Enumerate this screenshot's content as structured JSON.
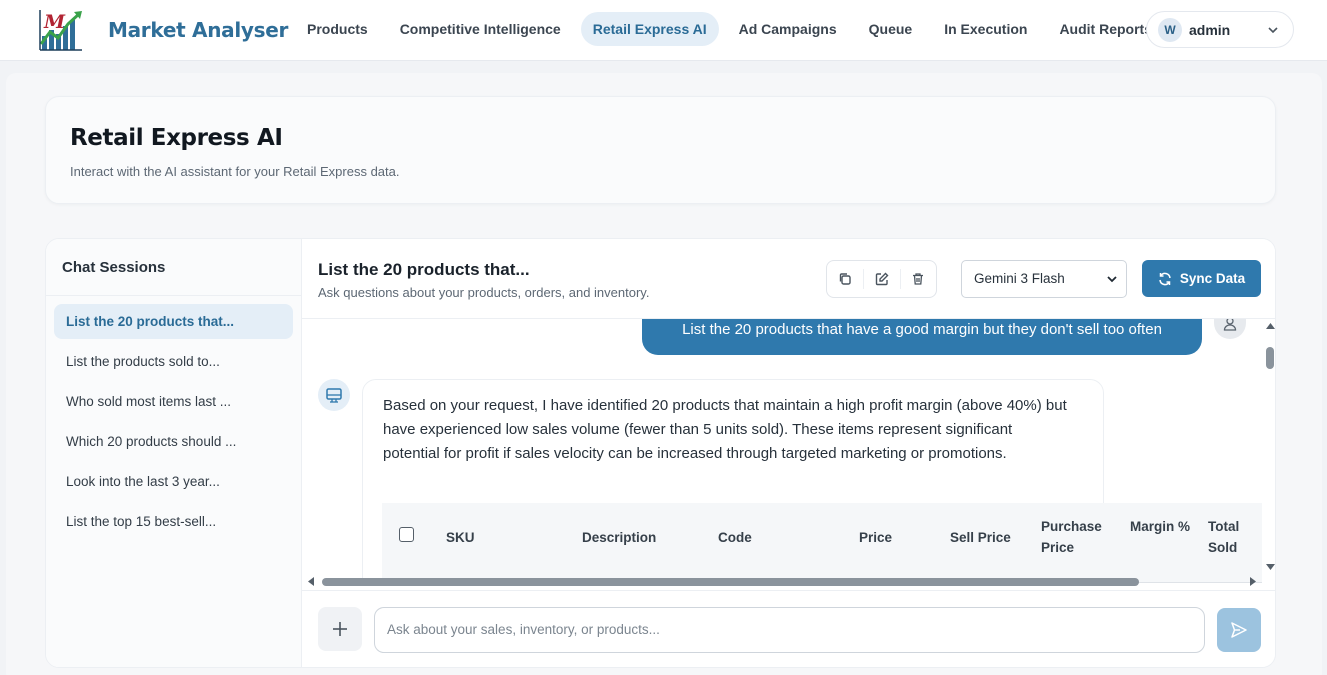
{
  "brand": {
    "logo_letter": "M",
    "name": "Market Analyser"
  },
  "nav": {
    "items": [
      {
        "label": "Products"
      },
      {
        "label": "Competitive Intelligence"
      },
      {
        "label": "Retail Express AI"
      },
      {
        "label": "Ad Campaigns"
      },
      {
        "label": "Queue"
      },
      {
        "label": "In Execution"
      },
      {
        "label": "Audit Reports"
      }
    ],
    "active": "Retail Express AI"
  },
  "user": {
    "initial": "W",
    "name": "admin"
  },
  "page": {
    "title": "Retail Express AI",
    "subtitle": "Interact with the AI assistant for your Retail Express data."
  },
  "sidebar": {
    "title": "Chat Sessions",
    "sessions": [
      {
        "label": "List the 20 products that..."
      },
      {
        "label": "List the products sold to..."
      },
      {
        "label": "Who sold most items last ..."
      },
      {
        "label": "Which 20 products should ..."
      },
      {
        "label": "Look into the last 3 year..."
      },
      {
        "label": "List the top 15 best-sell..."
      }
    ]
  },
  "chat": {
    "title": "List the 20 products that...",
    "subtitle": "Ask questions about your products, orders, and inventory.",
    "model": "Gemini 3 Flash",
    "sync_label": "Sync Data",
    "user_message": "List the 20 products that have a good margin but they don't sell too often",
    "bot_message": "Based on your request, I have identified 20 products that maintain a high profit margin (above 40%) but have experienced low sales volume (fewer than 5 units sold). These items represent significant potential for profit if sales velocity can be increased through targeted marketing or promotions.",
    "table_headers": {
      "sku": "SKU",
      "description": "Description",
      "code": "Code",
      "price": "Price",
      "sell_price": "Sell Price",
      "purchase_price": "Purchase Price",
      "margin": "Margin %",
      "total_sold": "Total Sold"
    },
    "input_placeholder": "Ask about your sales, inventory, or products..."
  },
  "colors": {
    "accent": "#2f79ad",
    "accent_light": "#e4eef7",
    "brand_text": "#2f6e98"
  },
  "icons": [
    "logo-chart-icon",
    "chevron-down-icon",
    "copy-icon",
    "edit-icon",
    "trash-icon",
    "refresh-icon",
    "user-icon",
    "bot-icon",
    "plus-icon",
    "send-icon"
  ]
}
